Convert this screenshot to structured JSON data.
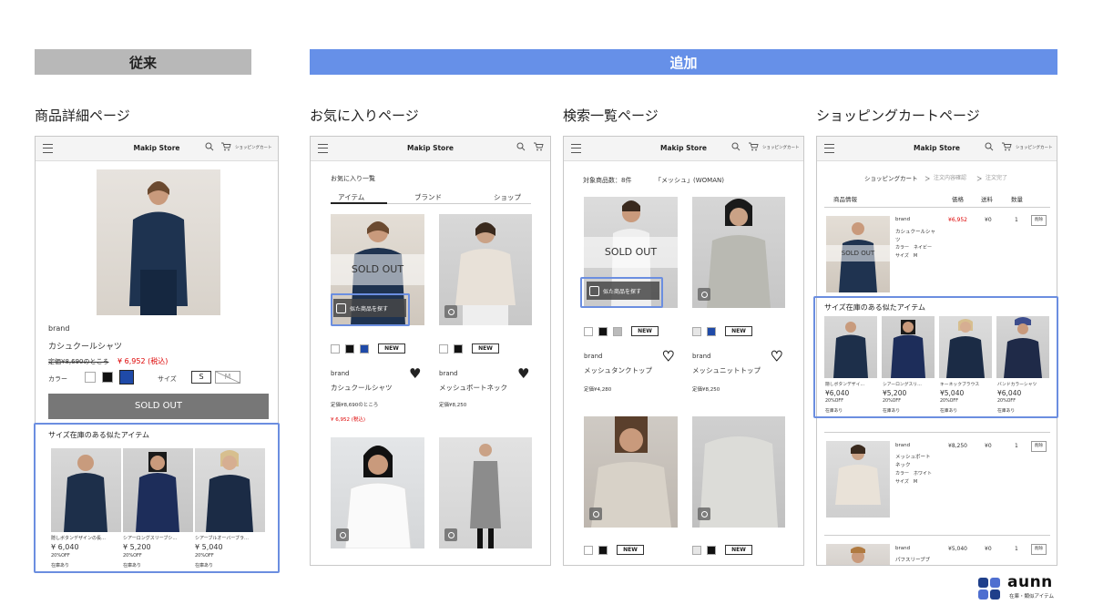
{
  "labels": {
    "before": "従来",
    "after": "追加"
  },
  "pages": {
    "detail": "商品詳細ページ",
    "favorites": "お気に入りページ",
    "search": "検索一覧ページ",
    "cart": "ショッピングカートページ"
  },
  "header": {
    "store": "Makip Store",
    "cart_label": "ショッピングカート"
  },
  "detail": {
    "brand": "brand",
    "name": "カシュクールシャツ",
    "price_orig": "定価¥8,690のところ",
    "price_sale": "¥ 6,952 (税込)",
    "color_label": "カラー",
    "size_label": "サイズ",
    "size_s": "S",
    "size_m": "M",
    "sold_out": "SOLD OUT",
    "similar_title": "サイズ在庫のある似たアイテム",
    "similar": [
      {
        "name": "隠しボタンデザインの長…",
        "price": "¥ 6,040",
        "off": "20%OFF",
        "stock": "在庫あり"
      },
      {
        "name": "シアーロングスリーブシ…",
        "price": "¥ 5,200",
        "off": "20%OFF",
        "stock": "在庫あり"
      },
      {
        "name": "シアーブルオーバーブラ…",
        "price": "¥ 5,040",
        "off": "20%OFF",
        "stock": "在庫あり"
      }
    ]
  },
  "favorites": {
    "title": "お気に入り一覧",
    "tabs": [
      "アイテム",
      "ブランド",
      "ショップ"
    ],
    "sold_out": "SOLD OUT",
    "similar_btn": "似た商品を探す",
    "new": "NEW",
    "items": [
      {
        "brand": "brand",
        "name": "カシュクールシャツ",
        "price": "定価¥8,690のところ",
        "sale": "¥ 6,952 (税込)"
      },
      {
        "brand": "brand",
        "name": "メッシュボートネック",
        "price": "定価¥8,250"
      }
    ]
  },
  "search": {
    "count": "対象商品数：8件",
    "query": "「メッシュ」(WOMAN)",
    "sold_out": "SOLD OUT",
    "similar_btn": "似た商品を探す",
    "new": "NEW",
    "items": [
      {
        "brand": "brand",
        "name": "メッシュタンクトップ",
        "price": "定価¥4,280"
      },
      {
        "brand": "brand",
        "name": "メッシュニットトップ",
        "price": "定価¥8,250"
      }
    ]
  },
  "cart": {
    "steps": [
      "ショッピングカート",
      "＞",
      "注文内容確認",
      "＞",
      "注文完了"
    ],
    "cols": [
      "商品情報",
      "価格",
      "送料",
      "数量"
    ],
    "sold_out": "SOLD OUT",
    "delete": "削除",
    "rows": [
      {
        "brand": "brand",
        "name1": "カシュクールシャ",
        "name2": "ツ",
        "color": "カラー　ネイビー",
        "size": "サイズ　M",
        "price": "¥6,952",
        "ship": "¥0",
        "qty": "1"
      },
      {
        "brand": "brand",
        "name1": "メッシュボート",
        "name2": "ネック",
        "color": "カラー　ホワイト",
        "size": "サイズ　M",
        "price": "¥8,250",
        "ship": "¥0",
        "qty": "1"
      },
      {
        "brand": "brand",
        "name1": "パフスリーブブ",
        "name2": "ラウス",
        "price": "¥5,040",
        "ship": "¥0",
        "qty": "1"
      }
    ],
    "similar_title": "サイズ在庫のある似たアイテム",
    "similar": [
      {
        "name": "隠しボタンデザイ…",
        "price": "¥6,040",
        "off": "20%OFF",
        "stock": "在庫あり"
      },
      {
        "name": "シアーロングスリ…",
        "price": "¥5,200",
        "off": "20%OFF",
        "stock": "在庫あり"
      },
      {
        "name": "キーネックブラウス",
        "price": "¥5,040",
        "off": "20%OFF",
        "stock": "在庫あり"
      },
      {
        "name": "バンドカラーシャツ",
        "price": "¥6,040",
        "off": "20%OFF",
        "stock": "在庫あり"
      }
    ]
  },
  "logo": {
    "name": "aunn",
    "sub": "在庫・類似アイテム"
  }
}
